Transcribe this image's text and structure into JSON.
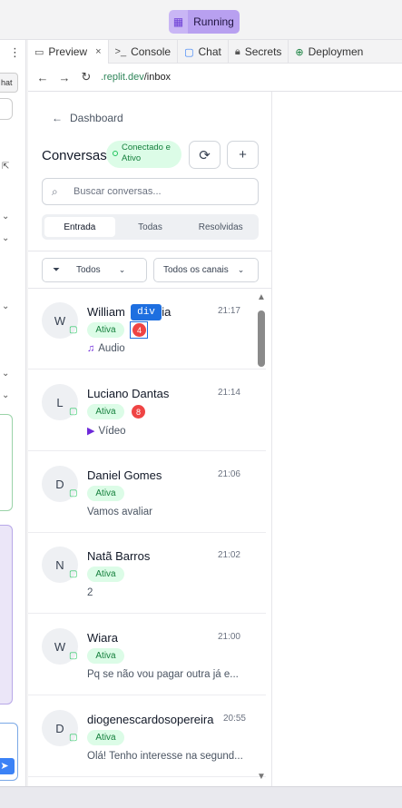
{
  "workspace": {
    "run_status": "Running"
  },
  "tabs": [
    {
      "label": "Preview",
      "icon": "monitor-icon",
      "active": true
    },
    {
      "label": "Console",
      "icon": "terminal-icon"
    },
    {
      "label": "Chat",
      "icon": "chat-bubble-icon"
    },
    {
      "label": "Secrets",
      "icon": "lock-icon"
    },
    {
      "label": "Deploymen",
      "icon": "globe-icon"
    }
  ],
  "addressbar": {
    "domain": ".replit.dev",
    "path": "/inbox"
  },
  "left_panel": {
    "button_label": "hat"
  },
  "inbox": {
    "back_label": "Dashboard",
    "title": "Conversas",
    "connection_status": "Conectado e Ativo",
    "search_placeholder": "Buscar conversas...",
    "segments": [
      "Entrada",
      "Todas",
      "Resolvidas"
    ],
    "filters": {
      "status": "Todos",
      "channels": "Todos os canais"
    },
    "inspector_tooltip": "div",
    "conversations": [
      {
        "initial": "W",
        "name_start": "William",
        "name_end": "ria",
        "time": "21:17",
        "status": "Ativa",
        "unread": "4",
        "preview": "Áudio",
        "preview_icon": "music-note-icon"
      },
      {
        "initial": "L",
        "name": "Luciano Dantas",
        "time": "21:14",
        "status": "Ativa",
        "unread": "8",
        "preview": "Vídeo",
        "preview_icon": "video-camera-icon"
      },
      {
        "initial": "D",
        "name": "Daniel Gomes",
        "time": "21:06",
        "status": "Ativa",
        "preview": "Vamos avaliar"
      },
      {
        "initial": "N",
        "name": "Natã Barros",
        "time": "21:02",
        "status": "Ativa",
        "preview": "2"
      },
      {
        "initial": "W",
        "name": "Wiara",
        "time": "21:00",
        "status": "Ativa",
        "preview": "Pq se não vou pagar outra já e..."
      },
      {
        "initial": "D",
        "name": "diogenescardosopereira",
        "time": "20:55",
        "status": "Ativa",
        "preview": "Olá! Tenho interesse na segund..."
      }
    ]
  }
}
